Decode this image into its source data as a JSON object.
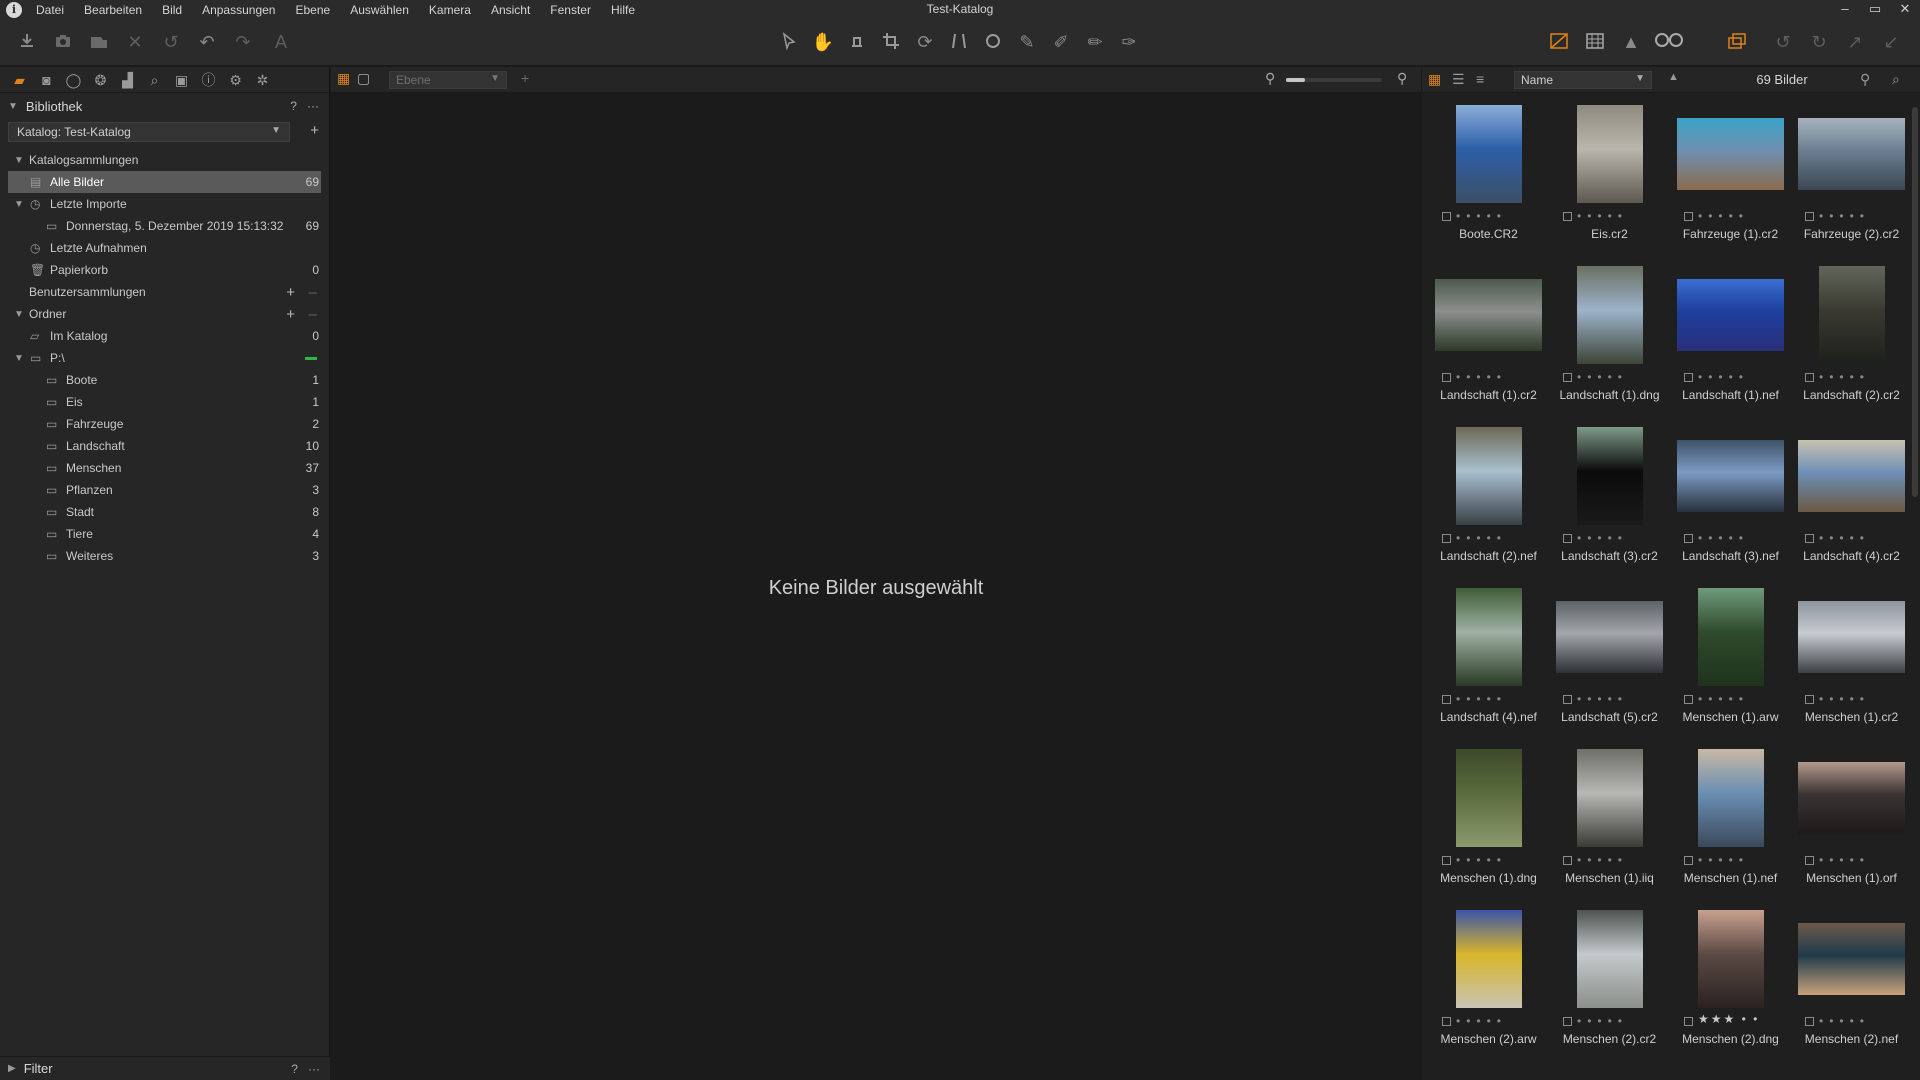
{
  "window": {
    "title": "Test-Katalog",
    "minimize": "–",
    "maximize": "▭",
    "close": "✕"
  },
  "menu": [
    "Datei",
    "Bearbeiten",
    "Bild",
    "Anpassungen",
    "Ebene",
    "Auswählen",
    "Kamera",
    "Ansicht",
    "Fenster",
    "Hilfe"
  ],
  "accent_color": "#e0821a",
  "library": {
    "title": "Bibliothek",
    "help": "?",
    "more": "···",
    "catalog_select": "Katalog: Test-Katalog",
    "catalog_collections": "Katalogsammlungen",
    "all_images": {
      "label": "Alle Bilder",
      "count": "69"
    },
    "recent_imports": "Letzte Importe",
    "import_entry": {
      "label": "Donnerstag, 5. Dezember 2019 15:13:32",
      "count": "69"
    },
    "recent_captures": "Letzte Aufnahmen",
    "trash": {
      "label": "Papierkorb",
      "count": "0"
    },
    "user_collections": "Benutzersammlungen",
    "folders": "Ordner",
    "in_catalog": {
      "label": "Im Katalog",
      "count": "0"
    },
    "drive": "P:\\",
    "folder_items": [
      {
        "label": "Boote",
        "count": "1"
      },
      {
        "label": "Eis",
        "count": "1"
      },
      {
        "label": "Fahrzeuge",
        "count": "2"
      },
      {
        "label": "Landschaft",
        "count": "10"
      },
      {
        "label": "Menschen",
        "count": "37"
      },
      {
        "label": "Pflanzen",
        "count": "3"
      },
      {
        "label": "Stadt",
        "count": "8"
      },
      {
        "label": "Tiere",
        "count": "4"
      },
      {
        "label": "Weiteres",
        "count": "3"
      }
    ],
    "filter": "Filter"
  },
  "viewer": {
    "layer_placeholder": "Ebene",
    "empty_message": "Keine Bilder ausgewählt",
    "zoom_level": 0.2
  },
  "browser": {
    "sort_by": "Name",
    "image_count": "69 Bilder",
    "thumbnails": [
      {
        "name": "Boote.CR2",
        "orientation": "portrait",
        "colors": [
          "#2d5fa8",
          "#8aaed8",
          "#3b4f66"
        ],
        "rating": 0
      },
      {
        "name": "Eis.cr2",
        "orientation": "portrait",
        "colors": [
          "#b9b6ad",
          "#8f8a80",
          "#5e5950"
        ],
        "rating": 0
      },
      {
        "name": "Fahrzeuge (1).cr2",
        "orientation": "landscape",
        "colors": [
          "#6f8fb0",
          "#3aa3c9",
          "#8a6b4e"
        ],
        "rating": 0
      },
      {
        "name": "Fahrzeuge (2).cr2",
        "orientation": "landscape",
        "colors": [
          "#6b7f92",
          "#a7b3bd",
          "#3b4753"
        ],
        "rating": 0
      },
      {
        "name": "Landschaft (1).cr2",
        "orientation": "landscape",
        "colors": [
          "#8c8f8d",
          "#4d5a4c",
          "#2c3a28"
        ],
        "rating": 0
      },
      {
        "name": "Landschaft (1).dng",
        "orientation": "portrait",
        "colors": [
          "#9cb3c9",
          "#6a6f62",
          "#3e4538"
        ],
        "rating": 0
      },
      {
        "name": "Landschaft (1).nef",
        "orientation": "landscape",
        "colors": [
          "#1d3f9e",
          "#3b6fd0",
          "#2a2f7a"
        ],
        "rating": 0
      },
      {
        "name": "Landschaft (2).cr2",
        "orientation": "portrait",
        "colors": [
          "#3a3a32",
          "#62675a",
          "#1d1f1a"
        ],
        "rating": 0
      },
      {
        "name": "Landschaft (2).nef",
        "orientation": "portrait",
        "colors": [
          "#a8c0cf",
          "#6d6a55",
          "#384046"
        ],
        "rating": 0
      },
      {
        "name": "Landschaft (3).cr2",
        "orientation": "portrait",
        "colors": [
          "#0b0b0b",
          "#7d9a88",
          "#1a1a1a"
        ],
        "rating": 0
      },
      {
        "name": "Landschaft (3).nef",
        "orientation": "landscape",
        "colors": [
          "#7c9bc4",
          "#3f5368",
          "#27313c"
        ],
        "rating": 0
      },
      {
        "name": "Landschaft (4).cr2",
        "orientation": "landscape",
        "colors": [
          "#6e8fb8",
          "#c8c2b0",
          "#6b5a44"
        ],
        "rating": 0
      },
      {
        "name": "Landschaft (4).nef",
        "orientation": "portrait",
        "colors": [
          "#9fb1a4",
          "#3f5d38",
          "#2a3a24"
        ],
        "rating": 0
      },
      {
        "name": "Landschaft (5).cr2",
        "orientation": "landscape",
        "colors": [
          "#a3a7ab",
          "#5c6266",
          "#2c3135"
        ],
        "rating": 0
      },
      {
        "name": "Menschen (1).arw",
        "orientation": "portrait",
        "colors": [
          "#2e4a2c",
          "#6f9c7c",
          "#1f331d"
        ],
        "rating": 0
      },
      {
        "name": "Menschen (1).cr2",
        "orientation": "landscape",
        "colors": [
          "#c7ccd2",
          "#8d949b",
          "#3b3f44"
        ],
        "rating": 0
      },
      {
        "name": "Menschen (1).dng",
        "orientation": "portrait",
        "colors": [
          "#5a6b3d",
          "#3d4a2b",
          "#8c9a6c"
        ],
        "rating": 0
      },
      {
        "name": "Menschen (1).iiq",
        "orientation": "portrait",
        "colors": [
          "#b7b8b4",
          "#6e6f68",
          "#3a3b35"
        ],
        "rating": 0
      },
      {
        "name": "Menschen (1).nef",
        "orientation": "portrait",
        "colors": [
          "#6a8fb3",
          "#c9b8a5",
          "#3b4a5c"
        ],
        "rating": 0
      },
      {
        "name": "Menschen (1).orf",
        "orientation": "landscape",
        "colors": [
          "#3a3333",
          "#b59a8d",
          "#1e1a1a"
        ],
        "rating": 0
      },
      {
        "name": "Menschen (2).arw",
        "orientation": "portrait",
        "colors": [
          "#d8b52a",
          "#3b55a8",
          "#c9c4b4"
        ],
        "rating": 0
      },
      {
        "name": "Menschen (2).cr2",
        "orientation": "portrait",
        "colors": [
          "#c4c9cc",
          "#4c5450",
          "#8a8f8a"
        ],
        "rating": 0
      },
      {
        "name": "Menschen (2).dng",
        "orientation": "portrait",
        "colors": [
          "#5b4a44",
          "#c9a08f",
          "#2b2220"
        ],
        "rating": 3
      },
      {
        "name": "Menschen (2).nef",
        "orientation": "landscape",
        "colors": [
          "#1f3a4a",
          "#6b5a4a",
          "#c9a27a"
        ],
        "rating": 0
      }
    ]
  }
}
